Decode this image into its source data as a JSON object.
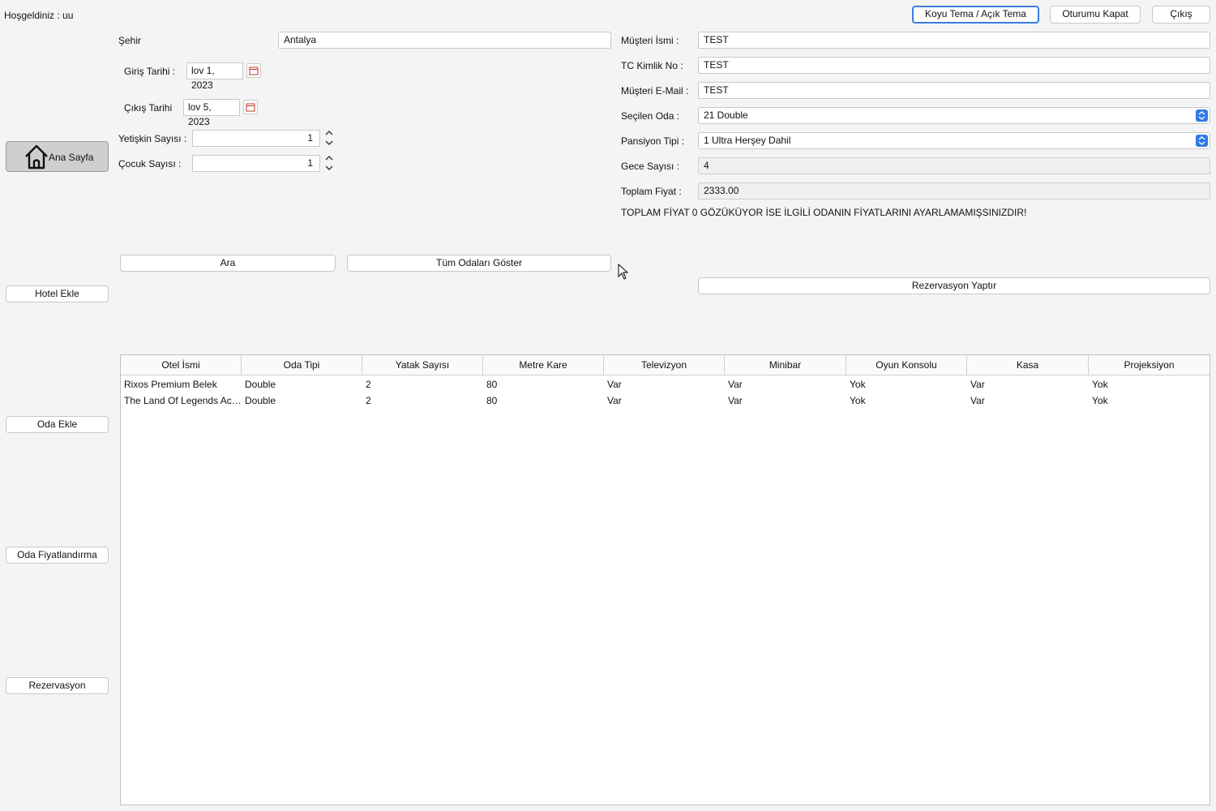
{
  "header": {
    "welcome": "Hoşgeldiniz : uu",
    "theme_button": "Koyu Tema / Açık Tema",
    "logout_button": "Oturumu Kapat",
    "exit_button": "Çıkış"
  },
  "sidebar": {
    "items": [
      {
        "label": "Ana Sayfa",
        "icon": "home-icon"
      },
      {
        "label": "Hotel Ekle"
      },
      {
        "label": "Oda Ekle"
      },
      {
        "label": "Oda Fiyatlandırma"
      },
      {
        "label": "Rezervasyon"
      }
    ]
  },
  "search": {
    "city_label": "Şehir",
    "city_value": "Antalya",
    "checkin_label": "Giriş Tarihi :",
    "checkin_value": "lov 1, 2023",
    "checkout_label": "Çıkış Tarihi",
    "checkout_value": "lov 5, 2023",
    "adults_label": "Yetişkin Sayısı :",
    "adults_value": "1",
    "children_label": "Çocuk Sayısı :",
    "children_value": "1",
    "search_button": "Ara",
    "show_all_button": "Tüm Odaları Göster"
  },
  "reservation": {
    "customer_name_label": "Müşteri İsmi :",
    "customer_name_value": "TEST",
    "tc_label": "TC Kimlik No :",
    "tc_value": "TEST",
    "email_label": "Müşteri E-Mail :",
    "email_value": "TEST",
    "room_label": "Seçilen Oda :",
    "room_value": "21 Double",
    "board_label": "Pansiyon Tipi :",
    "board_value": "1 Ultra Herşey Dahil",
    "nights_label": "Gece Sayısı :",
    "nights_value": "4",
    "total_label": "Toplam Fiyat :",
    "total_value": "2333.00",
    "warning": "TOPLAM FİYAT 0 GÖZÜKÜYOR İSE İLGİLİ ODANIN FİYATLARINI AYARLAMAMIŞSINIZDIR!",
    "submit_button": "Rezervasyon Yaptır"
  },
  "table": {
    "columns": [
      "Otel İsmi",
      "Oda Tipi",
      "Yatak Sayısı",
      "Metre Kare",
      "Televizyon",
      "Minibar",
      "Oyun Konsolu",
      "Kasa",
      "Projeksiyon"
    ],
    "rows": [
      [
        "Rixos Premium Belek",
        "Double",
        "2",
        "80",
        "Var",
        "Var",
        "Yok",
        "Var",
        "Yok"
      ],
      [
        "The Land Of Legends Acc...",
        "Double",
        "2",
        "80",
        "Var",
        "Var",
        "Yok",
        "Var",
        "Yok"
      ]
    ]
  },
  "colors": {
    "accent": "#2f7ae5",
    "background": "#f4f4f4"
  }
}
